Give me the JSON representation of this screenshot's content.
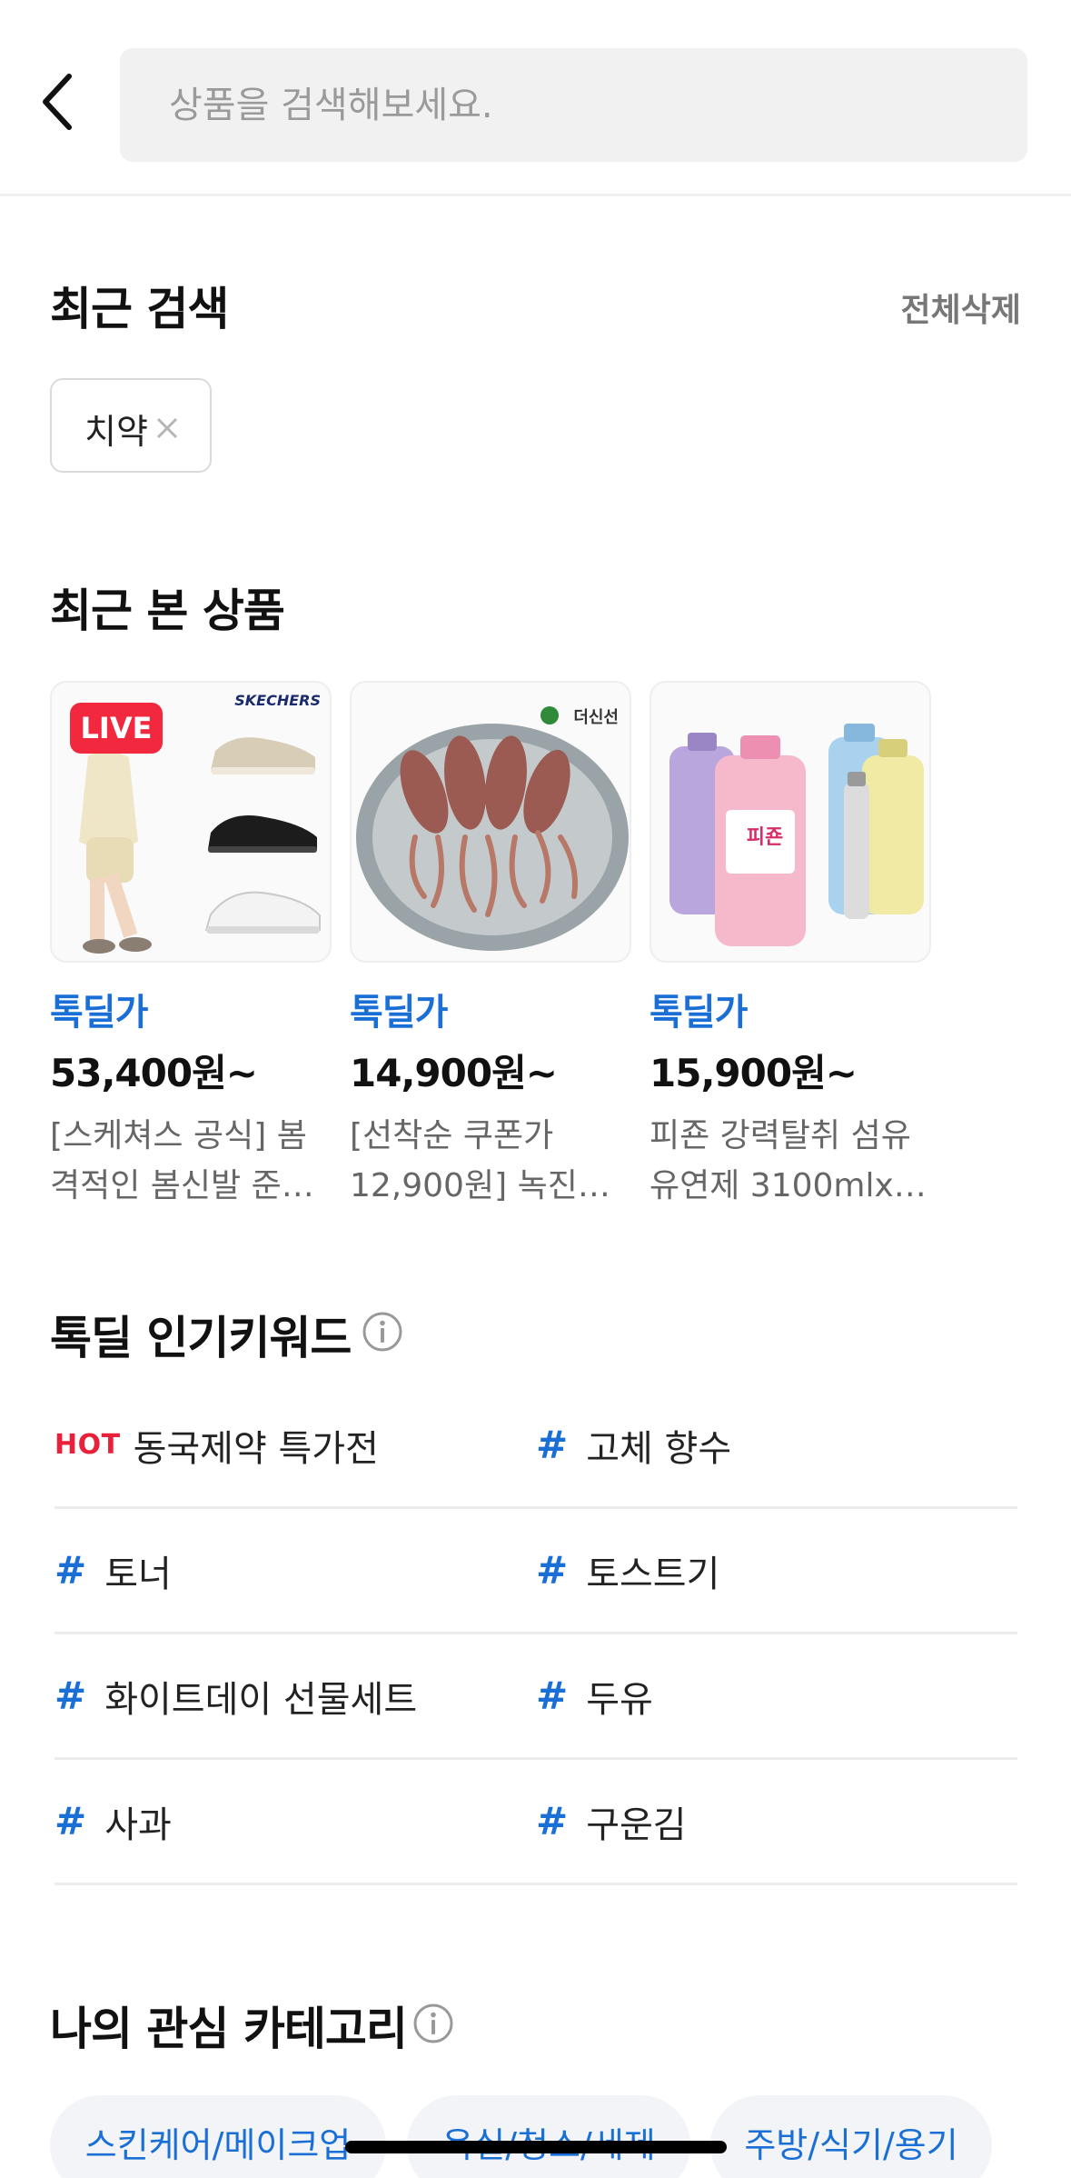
{
  "search": {
    "placeholder": "상품을 검색해보세요."
  },
  "recent_search": {
    "title": "최근 검색",
    "clear_all": "전체삭제",
    "items": [
      {
        "label": "치약"
      }
    ]
  },
  "recent_products": {
    "title": "최근 본 상품",
    "items": [
      {
        "live": "LIVE",
        "brand": "SKECHERS",
        "tag": "톡딜가",
        "price": "53,400원~",
        "desc_line1": "[스케쳐스 공식] 봄",
        "desc_line2": "격적인 봄신발 준…"
      },
      {
        "brand": "더신선",
        "tag": "톡딜가",
        "price": "14,900원~",
        "desc_line1": "[선착순 쿠폰가",
        "desc_line2": "12,900원] 녹진…"
      },
      {
        "brand": "피죤",
        "tag": "톡딜가",
        "price": "15,900원~",
        "desc_line1": "피죤 강력탈취 섬유",
        "desc_line2": "유연제 3100mlx…"
      }
    ]
  },
  "popular_keywords": {
    "title": "톡딜 인기키워드",
    "hot_label": "HOT",
    "hash": "#",
    "rows": [
      {
        "left": "동국제약 특가전",
        "right": "고체 향수"
      },
      {
        "left": "토너",
        "right": "토스트기"
      },
      {
        "left": "화이트데이 선물세트",
        "right": "두유"
      },
      {
        "left": "사과",
        "right": "구운김"
      }
    ]
  },
  "interest_categories": {
    "title": "나의 관심 카테고리",
    "items": [
      "스킨케어/메이크업",
      "욕실/청소/세제",
      "주방/식기/용기"
    ]
  },
  "colors": {
    "accent": "#1a6fd6",
    "hot": "#e8203a",
    "live": "#f2283f"
  }
}
